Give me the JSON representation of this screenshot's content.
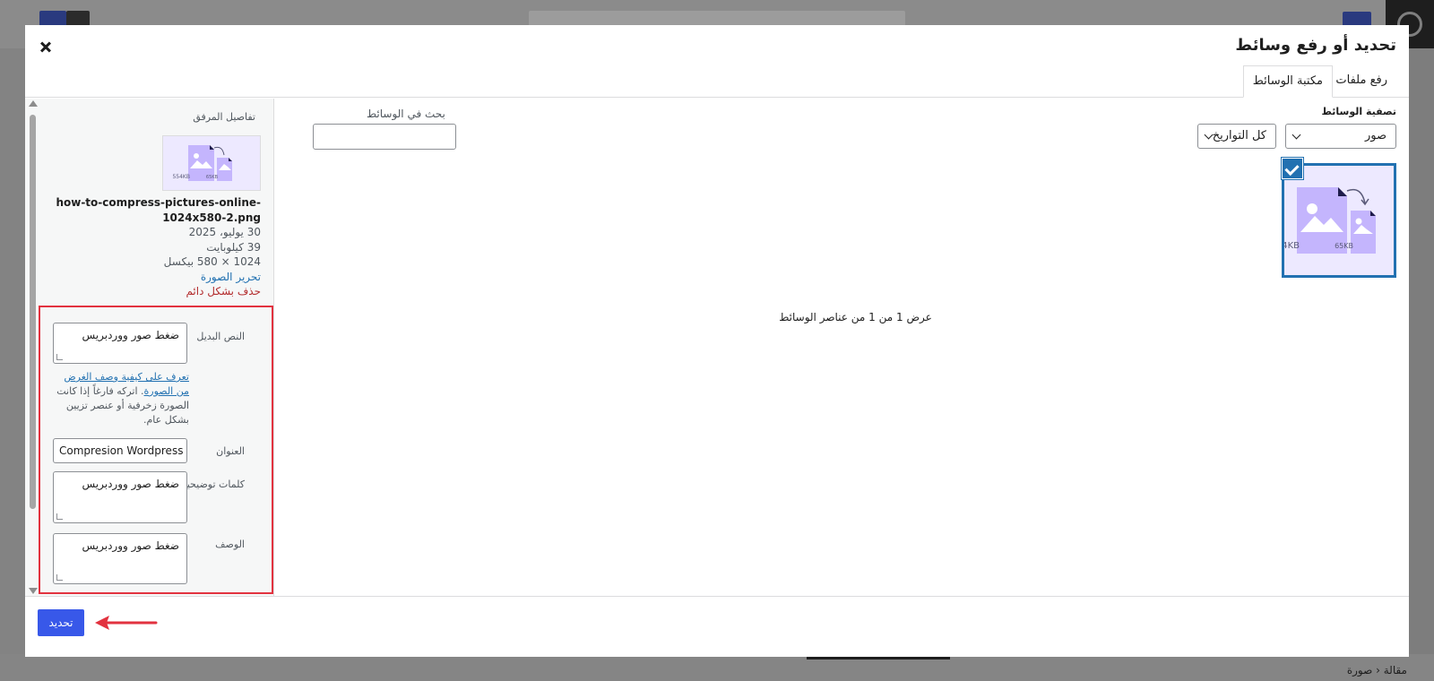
{
  "background": {
    "breadcrumb": "مقالة ‹ صورة"
  },
  "modal": {
    "title": "تحديد أو رفع وسائط",
    "tabs": {
      "upload": "رفع ملفات",
      "library": "مكتبة الوسائط"
    },
    "filters": {
      "label": "تصفية الوسائط",
      "type_value": "صور",
      "date_value": "كل التواريخ",
      "search_label": "بحث في الوسائط",
      "search_value": ""
    },
    "results_text": "عرض 1 من 1 من عناصر الوسائط",
    "attachment": {
      "heading": "تفاصيل المرفق",
      "filename": "how-to-compress-pictures-online-1024x580-2.png",
      "date": "30 يوليو، 2025",
      "filesize": "39 كيلوبايت",
      "dimensions": "1024 × 580 بيكسل",
      "edit_link": "تحرير الصورة",
      "delete_link": "حذف بشكل دائم",
      "thumb_sizes": [
        "554KB",
        "65KB"
      ]
    },
    "fields": {
      "alt_label": "النص البديل",
      "alt_value": "ضغط صور ووردبريس",
      "alt_help_link": "تعرف على كيفية وصف الغرض من الصورة",
      "alt_help_text": ". اتركه فارغاً إذا كانت الصورة زخرفية أو عنصر تزيين بشكل عام.",
      "title_label": "العنوان",
      "title_value": "Compresion Wordpress Image",
      "caption_label": "كلمات توضيحية",
      "caption_value": "ضغط صور ووردبريس",
      "description_label": "الوصف",
      "description_value": "ضغط صور ووردبريس"
    },
    "select_button": "تحديد"
  },
  "colors": {
    "accent": "#3858e9",
    "selected_border": "#2271b1",
    "highlight_box": "#e2323f",
    "thumb_bg": "#ede9ff",
    "thumb_icon": "#c4b5fd"
  }
}
